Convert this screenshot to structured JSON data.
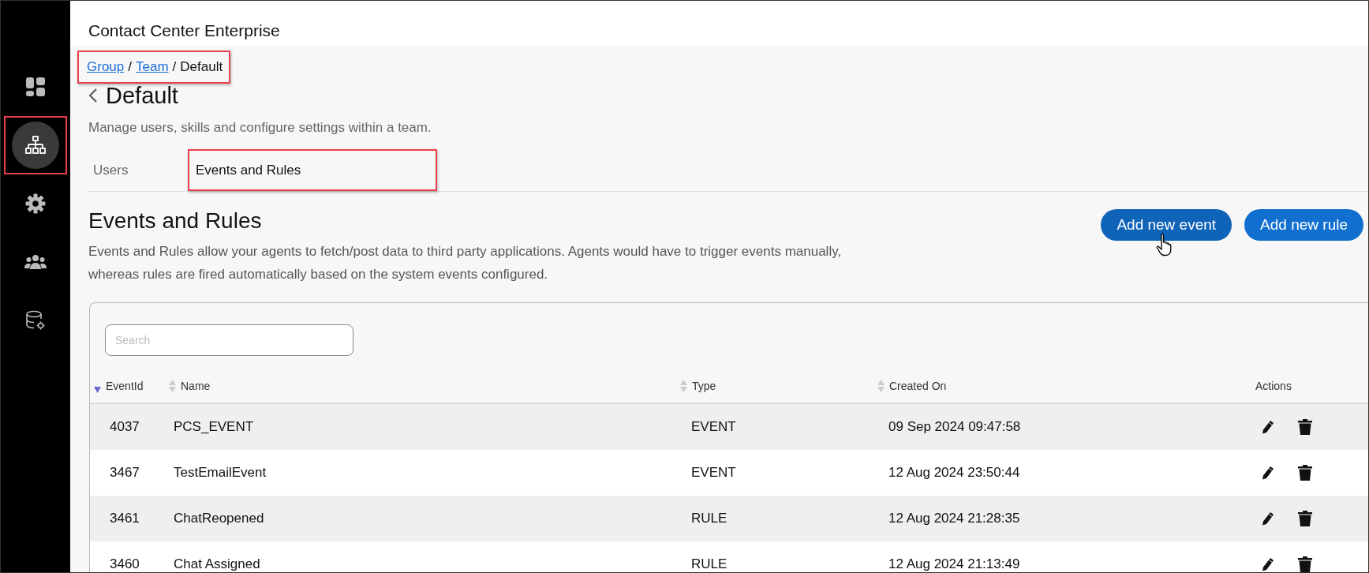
{
  "app_title": "Contact Center Enterprise",
  "sidebar": {
    "items": [
      {
        "kind": "dashboard",
        "selected": false,
        "highlighted": false
      },
      {
        "kind": "hierarchy",
        "selected": true,
        "highlighted": true
      },
      {
        "kind": "settings",
        "selected": false,
        "highlighted": false
      },
      {
        "kind": "people",
        "selected": false,
        "highlighted": false
      },
      {
        "kind": "database",
        "selected": false,
        "highlighted": false
      }
    ]
  },
  "breadcrumb": {
    "highlighted": true,
    "separator": "/",
    "items": [
      {
        "label": "Group",
        "kind": "link"
      },
      {
        "label": "Team",
        "kind": "link"
      },
      {
        "label": "Default",
        "kind": "current"
      }
    ]
  },
  "page": {
    "title": "Default",
    "description": "Manage users, skills and configure settings within a team."
  },
  "tabs": [
    {
      "label": "Users",
      "selected": false,
      "highlighted": false
    },
    {
      "label": "Events and Rules",
      "selected": true,
      "highlighted": true
    }
  ],
  "section": {
    "title": "Events and Rules",
    "description": "Events and Rules allow your agents to fetch/post data to third party applications. Agents would have to trigger events manually, whereas rules are fired automatically based on the system events configured.",
    "buttons": [
      {
        "label": "Add new event",
        "hovered": true
      },
      {
        "label": "Add new rule",
        "hovered": false
      }
    ]
  },
  "table": {
    "search": {
      "placeholder": "Search"
    },
    "columns": [
      {
        "label": "EventId",
        "sorted": true
      },
      {
        "label": "Name",
        "sorted": false
      },
      {
        "label": "Type",
        "sorted": false
      },
      {
        "label": "Created On",
        "sorted": false
      },
      {
        "label": "Actions"
      }
    ],
    "rows": [
      {
        "event_id": "4037",
        "name": "PCS_EVENT",
        "type": "EVENT",
        "created_on": "09 Sep 2024 09:47:58"
      },
      {
        "event_id": "3467",
        "name": "TestEmailEvent",
        "type": "EVENT",
        "created_on": "12 Aug 2024 23:50:44"
      },
      {
        "event_id": "3461",
        "name": "ChatReopened",
        "type": "RULE",
        "created_on": "12 Aug 2024 21:28:35"
      },
      {
        "event_id": "3460",
        "name": "Chat Assigned",
        "type": "RULE",
        "created_on": "12 Aug 2024 21:13:49"
      }
    ]
  }
}
